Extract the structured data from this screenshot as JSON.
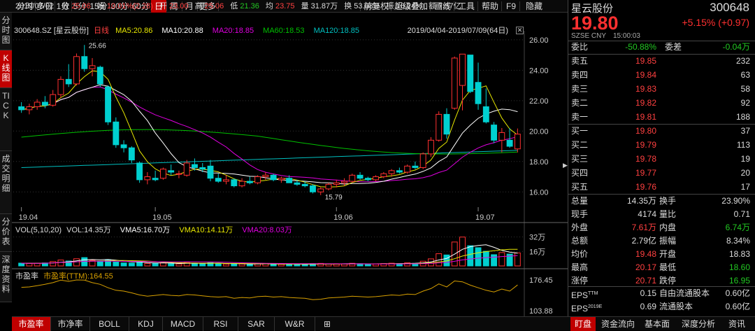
{
  "toolbar": {
    "items": [
      "分时",
      "多日",
      "1分",
      "5分",
      "15分",
      "30分",
      "60分",
      "日",
      "周",
      "月",
      "更多"
    ],
    "right_items": [
      "前复权",
      "超级叠加",
      "画线",
      "工具",
      "帮助",
      "F9",
      "隐藏"
    ]
  },
  "vtabs": [
    "分时图",
    "K线图",
    "TICK",
    "成交明细",
    "分价表",
    "深度资料"
  ],
  "quote_line": {
    "date": "2019/07/02",
    "close_label": "收",
    "close": "25.06",
    "amp_label": "幅",
    "amp": "10.01%(2.28)",
    "open_label": "开",
    "open": "23.00",
    "high_label": "高",
    "high": "25.06",
    "low_label": "低",
    "low": "21.36",
    "avg_label": "均",
    "avg": "23.75",
    "vol_label": "量",
    "vol": "31.87万",
    "turnover_label": "换",
    "turnover": "53.08%",
    "amplitude_label": "振",
    "amplitude": "16.24%",
    "amount_label": "额",
    "amount": "7.57亿"
  },
  "ma_line": {
    "code": "300648.SZ [星云股份]",
    "period": "日线",
    "ma5": "MA5:20.86",
    "ma10": "MA10:20.88",
    "ma20": "MA20:18.85",
    "ma60": "MA60:18.53",
    "ma120": "MA120:18.85",
    "range": "2019/04/04-2019/07/09(64日)"
  },
  "vol_line": {
    "label": "VOL(5,10,20)",
    "vol": "VOL:14.35万",
    "vma5": "VMA5:16.70万",
    "vma10": "VMA10:14.11万",
    "vma20": "VMA20:8.03万"
  },
  "pe_line": {
    "label": "市盈率",
    "value": "市盈率(TTM):164.55"
  },
  "colors": {
    "up": "#ff3030",
    "down": "#00d0d0",
    "ma5": "#e8e800",
    "ma10": "#ffffff",
    "ma20": "#e000e0",
    "ma60": "#00c000",
    "ma120": "#00c0c0",
    "pe": "#d8a000"
  },
  "chart_data": [
    {
      "type": "candlestick",
      "x_labels": [
        "19.04",
        "19.05",
        "19.06",
        "19.07"
      ],
      "y_ticks": [
        "26.00",
        "24.00",
        "22.00",
        "20.00",
        "18.00",
        "16.00"
      ],
      "ylim": [
        15.0,
        26.5
      ],
      "annotations": {
        "high_label": "25.66",
        "low_label": "15.79"
      },
      "ohlc": [
        [
          21.6,
          21.9,
          21.2,
          21.4
        ],
        [
          21.4,
          21.8,
          21.1,
          21.6
        ],
        [
          21.6,
          22.1,
          21.4,
          21.9
        ],
        [
          21.9,
          22.3,
          21.5,
          21.7
        ],
        [
          21.7,
          22.7,
          21.6,
          22.4
        ],
        [
          22.4,
          23.6,
          22.2,
          23.4
        ],
        [
          23.4,
          24.4,
          22.9,
          23.1
        ],
        [
          23.1,
          25.1,
          23.0,
          24.9
        ],
        [
          24.9,
          25.66,
          23.9,
          24.1
        ],
        [
          24.1,
          24.8,
          23.6,
          24.3
        ],
        [
          24.2,
          24.3,
          22.9,
          23.1
        ],
        [
          22.9,
          23.0,
          20.4,
          20.6
        ],
        [
          20.6,
          20.9,
          18.9,
          19.1
        ],
        [
          19.1,
          19.4,
          18.6,
          18.9
        ],
        [
          18.9,
          19.0,
          17.9,
          18.1
        ],
        [
          17.9,
          18.0,
          16.6,
          16.8
        ],
        [
          16.8,
          17.3,
          16.5,
          17.0
        ],
        [
          16.9,
          17.4,
          16.7,
          16.8
        ],
        [
          16.9,
          17.6,
          16.8,
          17.5
        ],
        [
          17.4,
          17.8,
          17.1,
          17.3
        ],
        [
          17.2,
          17.4,
          16.9,
          17.2
        ],
        [
          17.1,
          18.1,
          17.0,
          17.9
        ],
        [
          17.8,
          18.2,
          17.4,
          17.6
        ],
        [
          17.6,
          17.9,
          17.3,
          17.5
        ],
        [
          17.7,
          18.1,
          16.7,
          16.9
        ],
        [
          16.9,
          17.2,
          16.6,
          16.7
        ],
        [
          16.7,
          17.1,
          16.5,
          16.8
        ],
        [
          16.8,
          16.9,
          16.3,
          16.4
        ],
        [
          16.4,
          16.9,
          16.3,
          16.7
        ],
        [
          16.7,
          17.0,
          16.5,
          16.6
        ],
        [
          16.6,
          17.1,
          16.5,
          17.0
        ],
        [
          17.0,
          17.3,
          16.8,
          17.1
        ],
        [
          17.1,
          17.2,
          16.7,
          16.8
        ],
        [
          16.8,
          17.0,
          16.6,
          16.9
        ],
        [
          16.9,
          17.1,
          16.6,
          16.6
        ],
        [
          16.6,
          16.8,
          16.4,
          16.5
        ],
        [
          16.5,
          16.7,
          16.3,
          16.4
        ],
        [
          16.4,
          16.5,
          15.9,
          16.0
        ],
        [
          16.0,
          16.3,
          15.79,
          16.2
        ],
        [
          16.2,
          16.6,
          16.1,
          16.5
        ],
        [
          16.5,
          16.8,
          16.3,
          16.6
        ],
        [
          16.6,
          16.9,
          16.4,
          16.7
        ],
        [
          16.7,
          17.2,
          16.6,
          17.1
        ],
        [
          17.1,
          17.3,
          16.8,
          16.9
        ],
        [
          16.9,
          17.0,
          16.7,
          16.8
        ],
        [
          16.8,
          17.1,
          16.7,
          17.0
        ],
        [
          17.0,
          17.3,
          16.9,
          17.2
        ],
        [
          17.2,
          17.5,
          17.0,
          17.4
        ],
        [
          17.4,
          17.6,
          17.2,
          17.3
        ],
        [
          17.3,
          17.8,
          17.2,
          17.7
        ],
        [
          17.7,
          18.0,
          17.5,
          17.6
        ],
        [
          17.6,
          18.6,
          17.5,
          18.5
        ],
        [
          18.5,
          19.6,
          18.3,
          19.4
        ],
        [
          19.4,
          21.3,
          19.3,
          21.1
        ],
        [
          21.1,
          21.5,
          19.5,
          19.8
        ],
        [
          21.5,
          24.9,
          21.4,
          24.8
        ],
        [
          23.0,
          25.06,
          21.36,
          25.06
        ],
        [
          25.0,
          25.0,
          22.5,
          22.6
        ],
        [
          23.2,
          24.5,
          21.4,
          21.8
        ],
        [
          21.6,
          22.8,
          20.5,
          20.6
        ],
        [
          20.4,
          20.6,
          19.2,
          19.4
        ],
        [
          19.4,
          20.2,
          18.6,
          19.9
        ],
        [
          19.4,
          20.2,
          18.9,
          19.0
        ],
        [
          18.83,
          20.17,
          18.6,
          19.8
        ]
      ]
    },
    {
      "type": "bar",
      "title": "VOL(5,10,20)",
      "y_ticks": [
        "32万",
        "16万"
      ],
      "ylim": [
        0,
        34
      ],
      "values": [
        3.1,
        2.6,
        2.9,
        3.3,
        4.8,
        6.5,
        5.4,
        7.9,
        9.2,
        6.1,
        5.4,
        6.8,
        4.2,
        3.3,
        3.1,
        4.5,
        2.8,
        2.6,
        3.4,
        2.5,
        2.2,
        4.1,
        2.9,
        2.4,
        3.6,
        2.3,
        2.1,
        2.6,
        2.2,
        1.9,
        2.4,
        2.6,
        2.0,
        1.8,
        2.1,
        1.7,
        1.6,
        2.5,
        2.8,
        2.3,
        2.0,
        2.2,
        2.9,
        2.4,
        2.0,
        2.1,
        2.6,
        3.0,
        2.5,
        3.4,
        2.9,
        5.2,
        7.8,
        13.5,
        12.1,
        26.4,
        31.87,
        22.3,
        20.1,
        16.2,
        12.4,
        14.8,
        13.1,
        14.35
      ]
    },
    {
      "type": "line",
      "title": "市盈率",
      "y_ticks": [
        "176.45",
        "103.88"
      ],
      "ylim": [
        103.88,
        176.45
      ],
      "values": [
        159,
        160,
        163,
        166,
        170,
        176,
        173,
        176.45,
        176,
        170,
        166,
        158,
        152,
        150,
        146,
        141,
        138,
        140,
        142,
        140,
        139,
        142,
        141,
        139,
        137,
        136,
        137,
        133,
        135,
        134,
        137,
        138,
        136,
        137,
        135,
        134,
        133,
        130,
        131,
        134,
        135,
        136,
        138,
        137,
        136,
        137,
        139,
        141,
        140,
        143,
        142,
        150,
        156,
        167,
        160,
        174,
        172,
        164,
        158,
        152,
        148,
        155,
        150,
        164.55
      ]
    }
  ],
  "stock": {
    "name": "星云股份",
    "code": "300648",
    "price": "19.80",
    "change": "+5.15% (+0.97)",
    "market": "SZSE CNY",
    "time": "15:00:03"
  },
  "order_ratio": {
    "wb_label": "委比",
    "wb": "-50.88%",
    "wc_label": "委差",
    "wc": "-0.04万"
  },
  "asks": [
    {
      "label": "卖五",
      "price": "19.85",
      "vol": "232"
    },
    {
      "label": "卖四",
      "price": "19.84",
      "vol": "63"
    },
    {
      "label": "卖三",
      "price": "19.83",
      "vol": "58"
    },
    {
      "label": "卖二",
      "price": "19.82",
      "vol": "92"
    },
    {
      "label": "卖一",
      "price": "19.81",
      "vol": "188"
    }
  ],
  "bids": [
    {
      "label": "买一",
      "price": "19.80",
      "vol": "37"
    },
    {
      "label": "买二",
      "price": "19.79",
      "vol": "113"
    },
    {
      "label": "买三",
      "price": "19.78",
      "vol": "19"
    },
    {
      "label": "买四",
      "price": "19.77",
      "vol": "20"
    },
    {
      "label": "买五",
      "price": "19.76",
      "vol": "17"
    }
  ],
  "stats": [
    {
      "l1": "总量",
      "v1": "14.35万",
      "c1": "white",
      "l2": "换手",
      "v2": "23.90%",
      "c2": "white"
    },
    {
      "l1": "现手",
      "v1": "4174",
      "c1": "white",
      "l2": "量比",
      "v2": "0.71",
      "c2": "white"
    },
    {
      "l1": "外盘",
      "v1": "7.61万",
      "c1": "red",
      "l2": "内盘",
      "v2": "6.74万",
      "c2": "green"
    },
    {
      "l1": "总额",
      "v1": "2.79亿",
      "c1": "white",
      "l2": "振幅",
      "v2": "8.34%",
      "c2": "white"
    },
    {
      "l1": "均价",
      "v1": "19.48",
      "c1": "red",
      "l2": "开盘",
      "v2": "18.83",
      "c2": "white"
    },
    {
      "l1": "最高",
      "v1": "20.17",
      "c1": "red",
      "l2": "最低",
      "v2": "18.60",
      "c2": "green"
    },
    {
      "l1": "涨停",
      "v1": "20.71",
      "c1": "red",
      "l2": "跌停",
      "v2": "16.95",
      "c2": "green"
    }
  ],
  "fundamentals": [
    {
      "l1": "EPS",
      "sup1": "TTM",
      "v1": "0.15",
      "l2": "自由流通股本",
      "v2": "0.60亿"
    },
    {
      "l1": "EPS",
      "sup1": "2019E",
      "v1": "0.69",
      "l2": "流通股本",
      "v2": "0.60亿"
    }
  ],
  "bottom_tabs": [
    "市盈率",
    "市净率",
    "BOLL",
    "KDJ",
    "MACD",
    "RSI",
    "SAR",
    "W&R"
  ],
  "right_tabs": [
    "盯盘",
    "资金流向",
    "基本面",
    "深度分析",
    "资讯"
  ]
}
